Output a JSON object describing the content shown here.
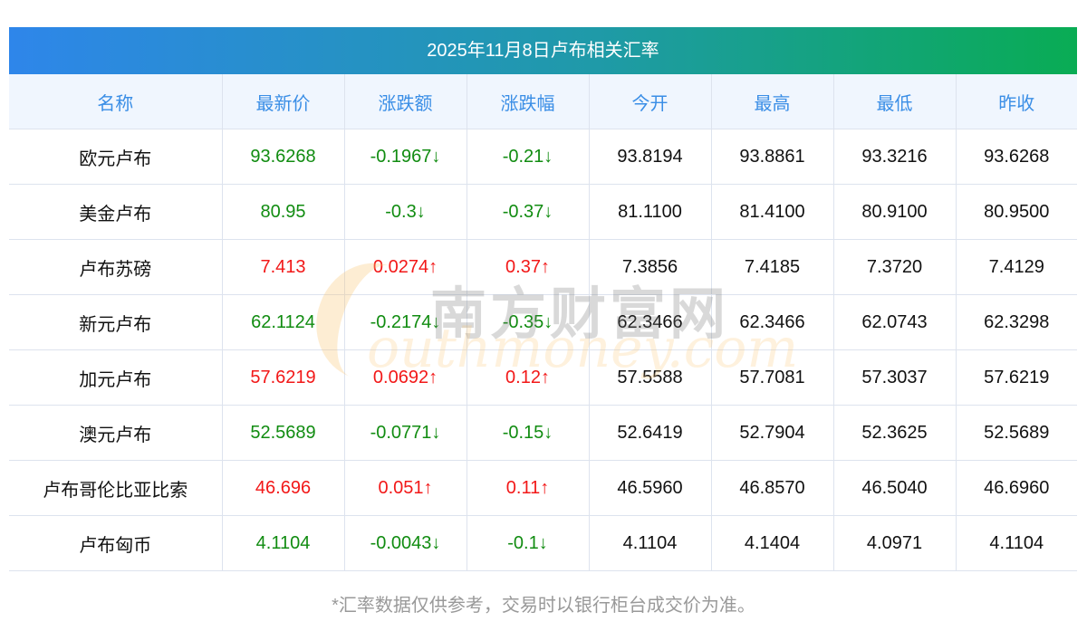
{
  "title": "2025年11月8日卢布相关汇率",
  "columns": [
    "名称",
    "最新价",
    "涨跌额",
    "涨跌幅",
    "今开",
    "最高",
    "最低",
    "昨收"
  ],
  "rows": [
    {
      "name": "欧元卢布",
      "latest": "93.6268",
      "change": "-0.1967↓",
      "pct": "-0.21↓",
      "open": "93.8194",
      "high": "93.8861",
      "low": "93.3216",
      "prev": "93.6268",
      "trend": "down"
    },
    {
      "name": "美金卢布",
      "latest": "80.95",
      "change": "-0.3↓",
      "pct": "-0.37↓",
      "open": "81.1100",
      "high": "81.4100",
      "low": "80.9100",
      "prev": "80.9500",
      "trend": "down"
    },
    {
      "name": "卢布苏磅",
      "latest": "7.413",
      "change": "0.0274↑",
      "pct": "0.37↑",
      "open": "7.3856",
      "high": "7.4185",
      "low": "7.3720",
      "prev": "7.4129",
      "trend": "up"
    },
    {
      "name": "新元卢布",
      "latest": "62.1124",
      "change": "-0.2174↓",
      "pct": "-0.35↓",
      "open": "62.3466",
      "high": "62.3466",
      "low": "62.0743",
      "prev": "62.3298",
      "trend": "down"
    },
    {
      "name": "加元卢布",
      "latest": "57.6219",
      "change": "0.0692↑",
      "pct": "0.12↑",
      "open": "57.5588",
      "high": "57.7081",
      "low": "57.3037",
      "prev": "57.6219",
      "trend": "up"
    },
    {
      "name": "澳元卢布",
      "latest": "52.5689",
      "change": "-0.0771↓",
      "pct": "-0.15↓",
      "open": "52.6419",
      "high": "52.7904",
      "low": "52.3625",
      "prev": "52.5689",
      "trend": "down"
    },
    {
      "name": "卢布哥伦比亚比索",
      "latest": "46.696",
      "change": "0.051↑",
      "pct": "0.11↑",
      "open": "46.5960",
      "high": "46.8570",
      "low": "46.5040",
      "prev": "46.6960",
      "trend": "up"
    },
    {
      "name": "卢布匈币",
      "latest": "4.1104",
      "change": "-0.0043↓",
      "pct": "-0.1↓",
      "open": "4.1104",
      "high": "4.1404",
      "low": "4.0971",
      "prev": "4.1104",
      "trend": "down"
    }
  ],
  "watermark": {
    "cn": "南方财富网",
    "en": "outhmoney.com"
  },
  "footer": "*汇率数据仅供参考，交易时以银行柜台成交价为准。",
  "colors": {
    "up": "#f21818",
    "down": "#118c11",
    "header_text": "#3a8ee6"
  }
}
